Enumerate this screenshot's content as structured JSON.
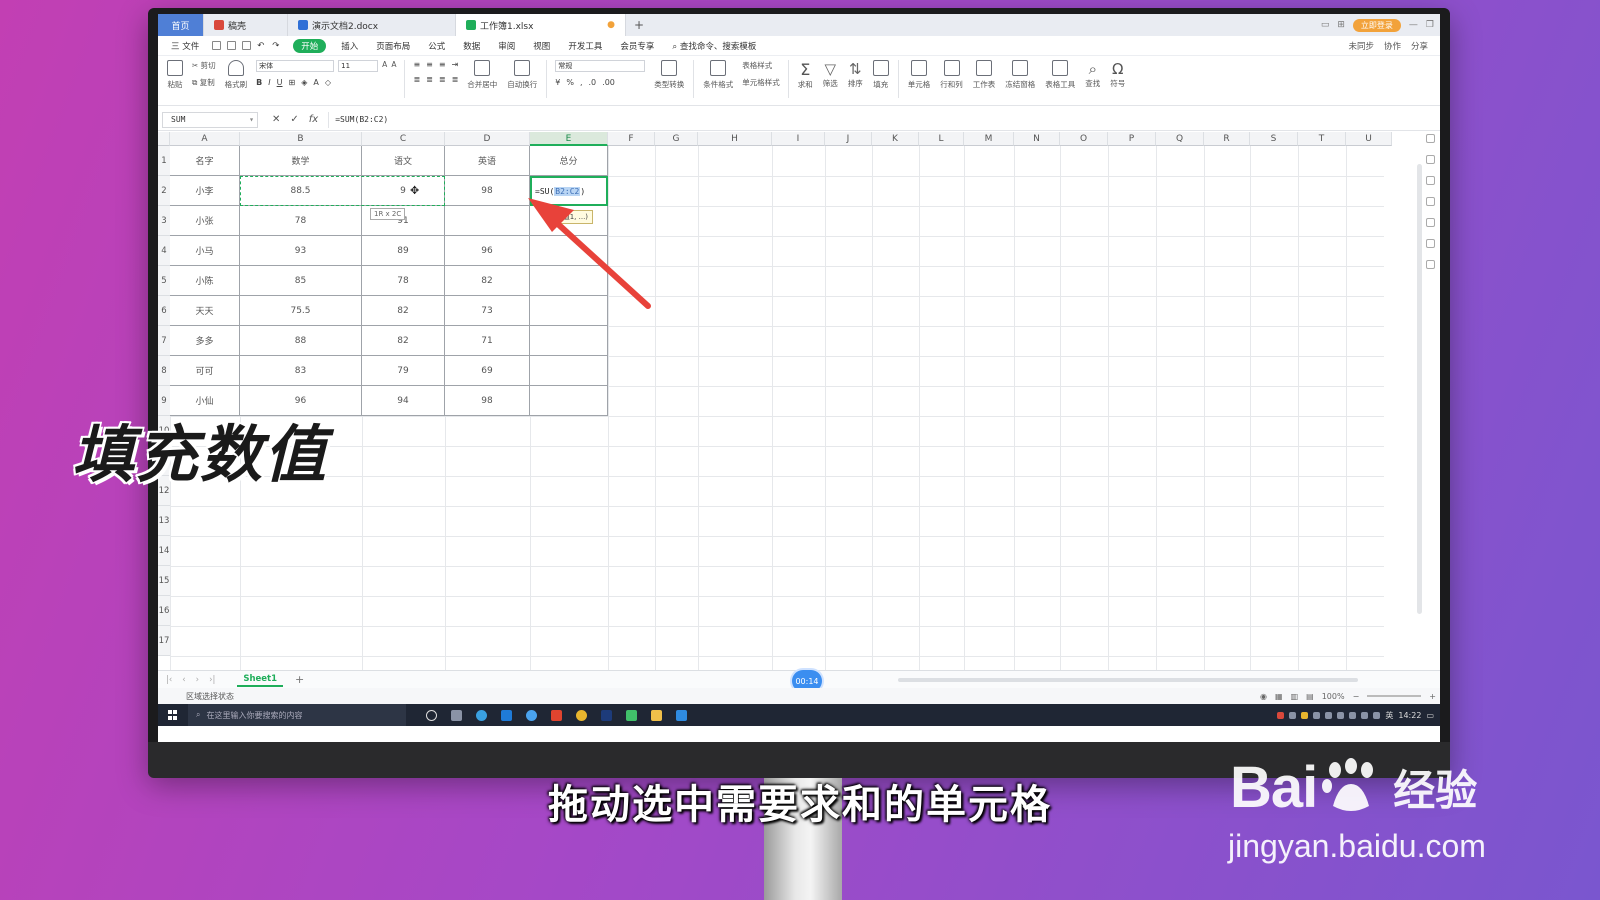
{
  "titlebar": {
    "home_tab": "首页",
    "tabs": [
      {
        "label": "稿壳",
        "color": "#d9483b"
      },
      {
        "label": "演示文档2.docx",
        "color": "#2f6fd6"
      },
      {
        "label": "工作簿1.xlsx",
        "color": "#1fae5a"
      }
    ],
    "new_tab": "+",
    "login_label": "立即登录"
  },
  "menubar": {
    "file": "三 文件",
    "items": [
      "开始",
      "插入",
      "页面布局",
      "公式",
      "数据",
      "审阅",
      "视图",
      "开发工具",
      "会员专享"
    ],
    "active": "开始",
    "search_placeholder": "查找命令、搜索模板",
    "right": [
      "未同步",
      "协作",
      "分享"
    ]
  },
  "ribbon": {
    "paste": "粘贴",
    "cut": "剪切",
    "copy": "复制",
    "format_painter": "格式刷",
    "font_name": "宋体",
    "font_size": "11",
    "number_format": "常规",
    "merge": "合并居中",
    "wrap": "自动换行",
    "type_convert": "类型转换",
    "cond_format": "条件格式",
    "table_style": "表格样式",
    "cell_style": "单元格样式",
    "sum": "求和",
    "filter": "筛选",
    "sort": "排序",
    "fill": "填充",
    "cell": "单元格",
    "row_col": "行和列",
    "worksheet": "工作表",
    "freeze": "冻结窗格",
    "table_tools": "表格工具",
    "find": "查找",
    "symbol": "符号"
  },
  "formula_bar": {
    "name_box": "SUM",
    "formula": "=SUM(B2:C2)",
    "fx": "fx"
  },
  "columns": [
    "A",
    "B",
    "C",
    "D",
    "E",
    "F",
    "G",
    "H",
    "I",
    "J",
    "K",
    "L",
    "M",
    "N",
    "O",
    "P",
    "Q",
    "R",
    "S",
    "T",
    "U"
  ],
  "selected_column": "E",
  "row_numbers": [
    "1",
    "2",
    "3",
    "4",
    "5",
    "6",
    "7",
    "8",
    "9",
    "10",
    "11",
    "12",
    "13",
    "14",
    "15",
    "16",
    "17"
  ],
  "table": {
    "headers": [
      "名字",
      "数学",
      "语文",
      "英语",
      "总分"
    ],
    "rows": [
      [
        "小李",
        "88.5",
        "9",
        "98",
        ""
      ],
      [
        "小张",
        "78",
        "91",
        "",
        ""
      ],
      [
        "小马",
        "93",
        "89",
        "96",
        ""
      ],
      [
        "小陈",
        "85",
        "78",
        "82",
        ""
      ],
      [
        "天天",
        "75.5",
        "82",
        "73",
        ""
      ],
      [
        "多多",
        "88",
        "82",
        "71",
        ""
      ],
      [
        "可可",
        "83",
        "79",
        "69",
        ""
      ],
      [
        "小仙",
        "96",
        "94",
        "98",
        ""
      ]
    ]
  },
  "active_cell": {
    "prefix": "=SU",
    "ref": "B2:C2",
    "suffix": ")",
    "open": "("
  },
  "tooltips": {
    "selection_size": "1R x 2C",
    "args": "(数值1, ...)"
  },
  "sheets": {
    "tabs": [
      "Sheet1"
    ],
    "add": "+"
  },
  "timer": "00:14",
  "statusbar": {
    "left": "区域选择状态",
    "zoom": "100%"
  },
  "taskbar": {
    "search_placeholder": "在这里输入你要搜索的内容",
    "time": "14:22",
    "ime": "英"
  },
  "overlay": {
    "caption_left": "填充数值",
    "subtitle": "拖动选中需要求和的单元格",
    "watermark_brand_a": "Bai",
    "watermark_brand_b": "经验",
    "watermark_url": "jingyan.baidu.com"
  },
  "colors": {
    "accent_green": "#1fae5a",
    "arrow_red": "#e8423a",
    "background_left": "#c23fb3",
    "background_right": "#7a56cf"
  }
}
